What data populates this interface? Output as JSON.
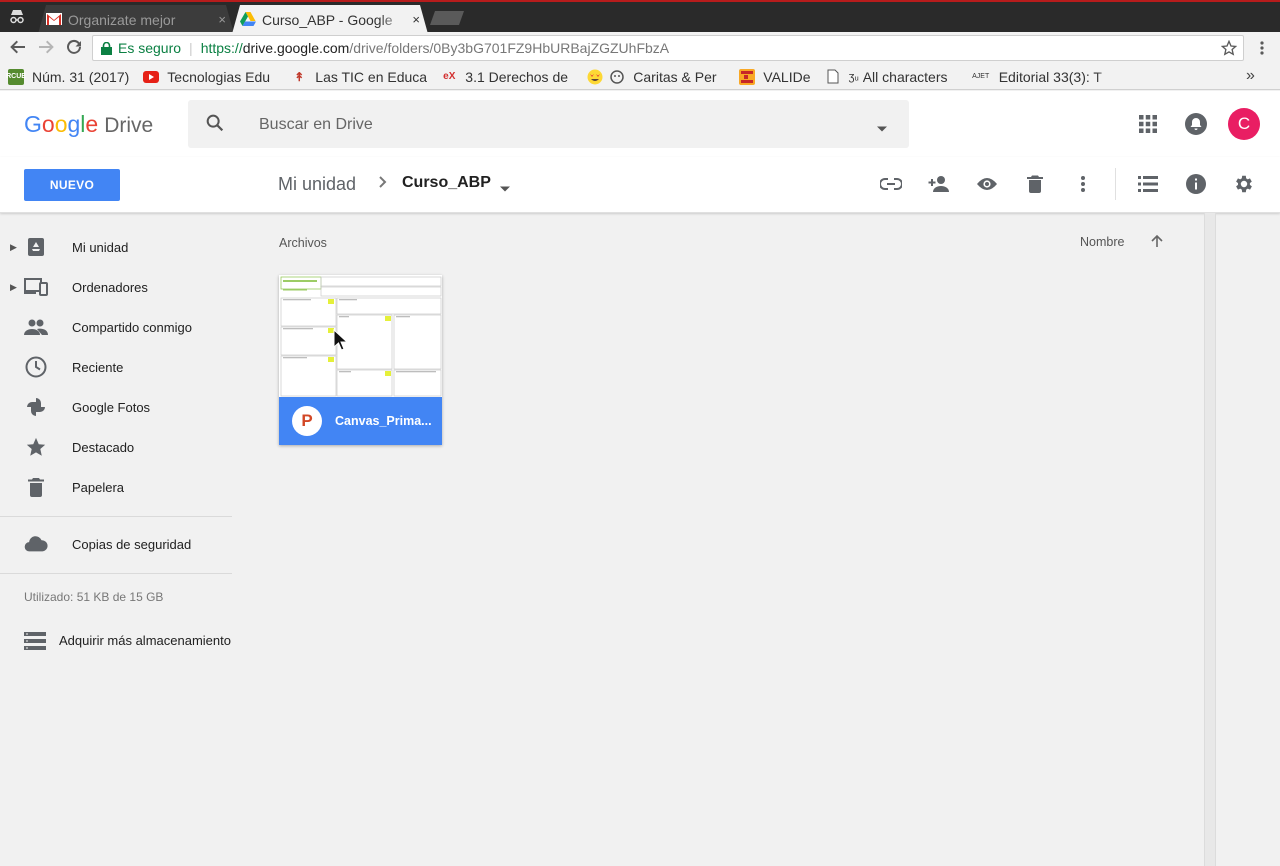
{
  "browser": {
    "tabs": [
      {
        "title": "Organizate mejor",
        "icon": "gmail-icon",
        "active": false
      },
      {
        "title": "Curso_ABP - Google",
        "icon": "drive-icon",
        "active": true
      }
    ],
    "close_glyph": "×",
    "address": {
      "secure_label": "Es seguro",
      "scheme": "https://",
      "host": "drive.google.com",
      "path": "/drive/folders/0By3bG701FZ9HbURBajZGZUhFbzA"
    },
    "bookmarks": [
      {
        "label": "Núm. 31 (2017)",
        "icon": "rcue-icon"
      },
      {
        "label": "Tecnologias Edu",
        "icon": "youtube-icon"
      },
      {
        "label": "Las TIC en Educa",
        "icon": "tic-icon"
      },
      {
        "label": "3.1 Derechos de",
        "icon": "edx-icon"
      },
      {
        "label": "Caritas & Per",
        "icon": "emoji-icon"
      },
      {
        "label": "VALIDe",
        "icon": "valide-icon"
      },
      {
        "label": "All characters",
        "icon": "page-icon"
      },
      {
        "label": "Editorial 33(3): T",
        "icon": "ajet-icon"
      }
    ],
    "more_glyph": "»"
  },
  "drive": {
    "logo_google": [
      "G",
      "o",
      "o",
      "g",
      "l",
      "e"
    ],
    "logo_product": "Drive",
    "search_placeholder": "Buscar en Drive",
    "avatar_letter": "C",
    "new_button": "NUEVO",
    "breadcrumb": {
      "root": "Mi unidad",
      "current": "Curso_ABP"
    },
    "sidebar": [
      {
        "label": "Mi unidad",
        "icon": "my-drive-icon",
        "expandable": true
      },
      {
        "label": "Ordenadores",
        "icon": "computers-icon",
        "expandable": true
      },
      {
        "label": "Compartido conmigo",
        "icon": "shared-people-icon",
        "expandable": false
      },
      {
        "label": "Reciente",
        "icon": "clock-icon",
        "expandable": false
      },
      {
        "label": "Google Fotos",
        "icon": "pinwheel-icon",
        "expandable": false
      },
      {
        "label": "Destacado",
        "icon": "star-icon",
        "expandable": false
      },
      {
        "label": "Papelera",
        "icon": "trash-icon",
        "expandable": false
      }
    ],
    "backups_label": "Copias de seguridad",
    "storage_text": "Utilizado: 51 KB de 15 GB",
    "buy_storage": "Adquirir más almacenamiento",
    "section_label": "Archivos",
    "sort_label": "Nombre",
    "file": {
      "name": "Canvas_Prima...",
      "type_letter": "P"
    },
    "colors": {
      "accent": "#4285f4",
      "avatar": "#e91e63",
      "pptx": "#d24726"
    }
  }
}
